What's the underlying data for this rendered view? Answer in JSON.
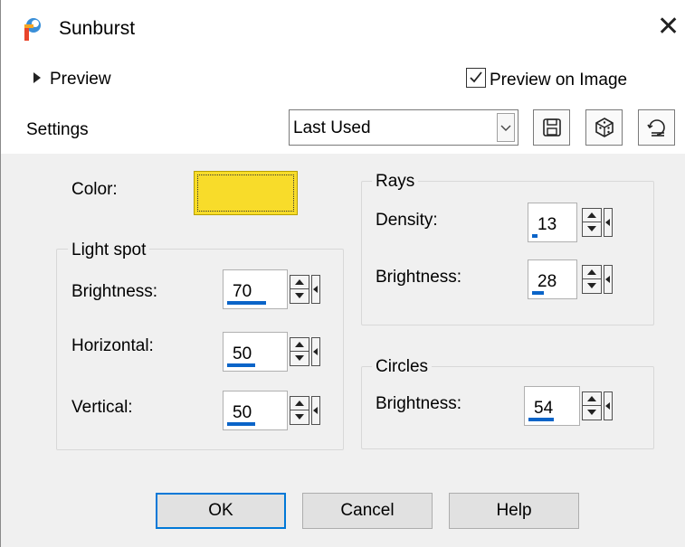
{
  "window": {
    "title": "Sunburst"
  },
  "header": {
    "preview_toggle_label": "Preview",
    "preview_on_image_label": "Preview on Image",
    "preview_on_image_checked": true
  },
  "settings": {
    "label": "Settings",
    "preset_value": "Last Used"
  },
  "color": {
    "label": "Color:",
    "value": "#f8dc2a"
  },
  "light_spot": {
    "title": "Light spot",
    "brightness": {
      "label": "Brightness:",
      "value": "70",
      "level": 0.7
    },
    "horizontal": {
      "label": "Horizontal:",
      "value": "50",
      "level": 0.5
    },
    "vertical": {
      "label": "Vertical:",
      "value": "50",
      "level": 0.5
    }
  },
  "rays": {
    "title": "Rays",
    "density": {
      "label": "Density:",
      "value": "13",
      "level": 0.13
    },
    "brightness": {
      "label": "Brightness:",
      "value": "28",
      "level": 0.28
    }
  },
  "circles": {
    "title": "Circles",
    "brightness": {
      "label": "Brightness:",
      "value": "54",
      "level": 0.54
    }
  },
  "buttons": {
    "ok": "OK",
    "cancel": "Cancel",
    "help": "Help"
  },
  "colors": {
    "accent": "#0a64c8",
    "default_border": "#0078d7"
  }
}
